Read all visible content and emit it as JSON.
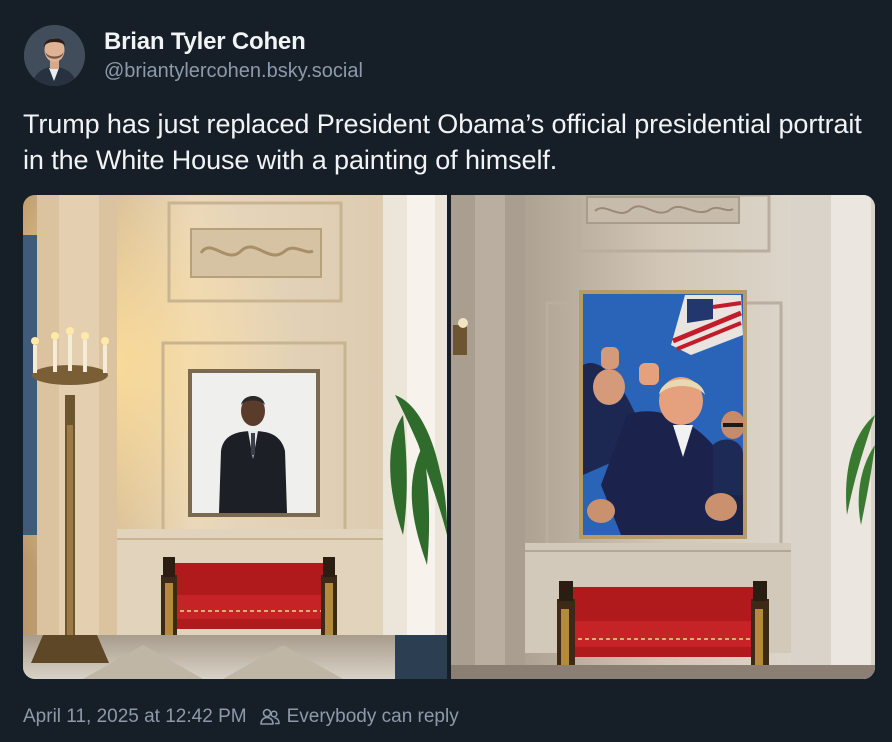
{
  "author": {
    "display_name": "Brian Tyler Cohen",
    "handle": "@briantylercohen.bsky.social",
    "avatar_icon": "profile-photo"
  },
  "post": {
    "text": "Trump has just replaced President Obama’s official presidential portrait in the White House with a painting of himself."
  },
  "images": [
    {
      "description_icon": "photo-obama-portrait-hallway"
    },
    {
      "description_icon": "photo-trump-painting-hallway"
    }
  ],
  "footer": {
    "timestamp": "April 11, 2025 at 12:42 PM",
    "reply_setting": "Everybody can reply",
    "reply_icon": "people-icon"
  },
  "colors": {
    "background": "#161e27",
    "text_primary": "#f1f3f5",
    "text_secondary": "#8d9aab"
  }
}
